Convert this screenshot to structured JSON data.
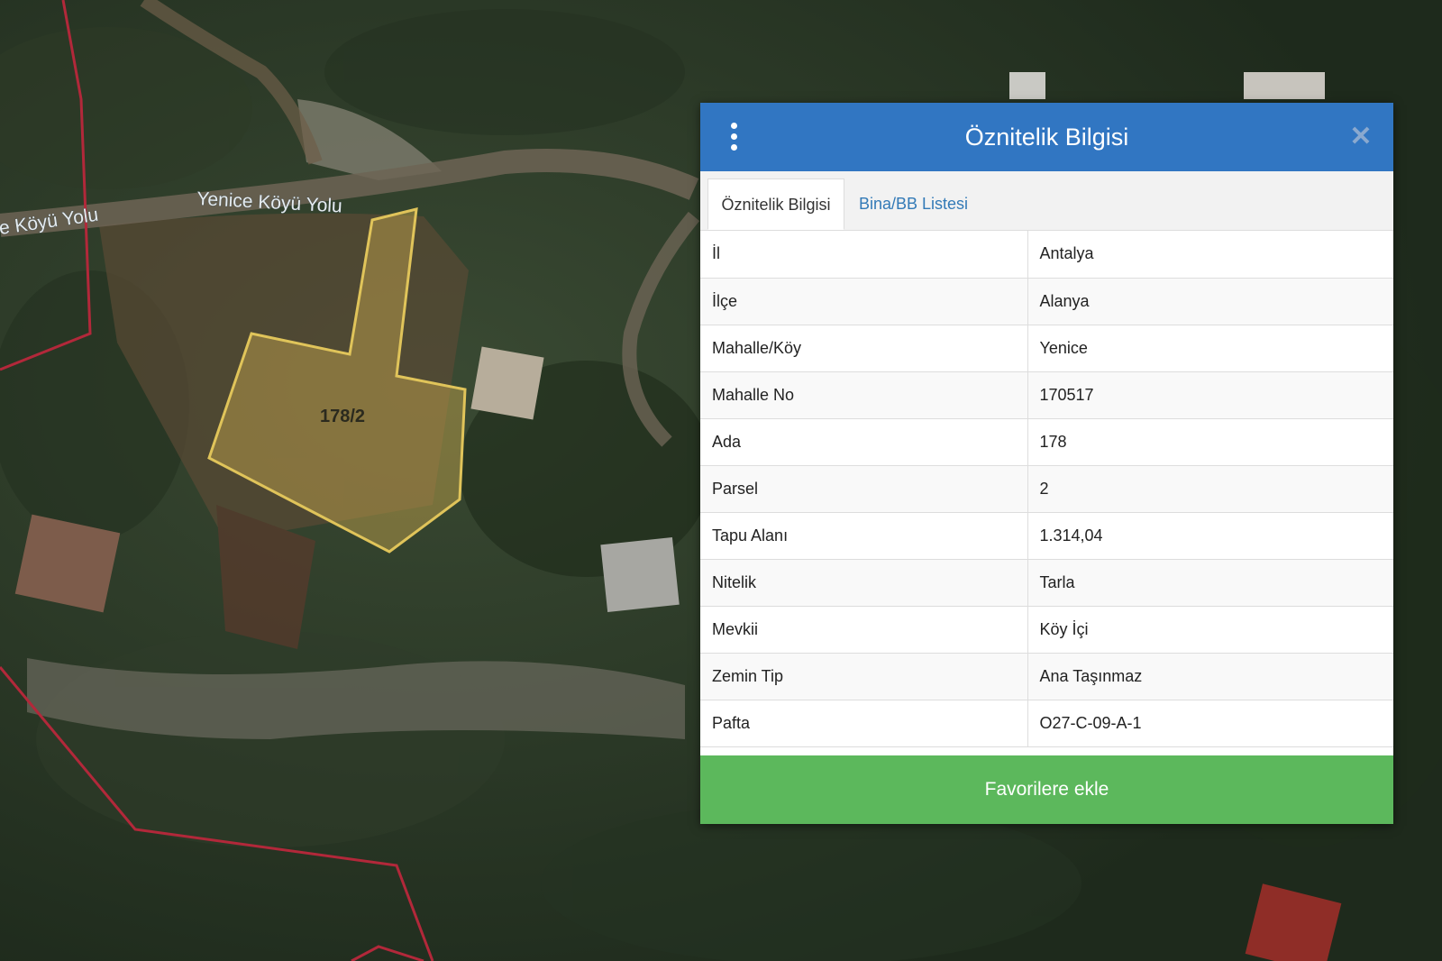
{
  "map": {
    "road_label_left": "e Köyü Yolu",
    "road_label_main": "Yenice Köyü Yolu",
    "parcel_label": "178/2",
    "colors": {
      "parcel_fill": "#c9a94e",
      "parcel_stroke": "#e0c45a",
      "boundary_line": "#b2283a"
    }
  },
  "panel": {
    "title": "Öznitelik Bilgisi",
    "menu_icon": "kebab-menu-icon",
    "close_icon": "close-icon",
    "header_color": "#3176c2",
    "tabs": [
      {
        "label": "Öznitelik Bilgisi",
        "active": true
      },
      {
        "label": "Bina/BB Listesi",
        "active": false
      }
    ],
    "rows": [
      {
        "key": "İl",
        "value": "Antalya"
      },
      {
        "key": "İlçe",
        "value": "Alanya"
      },
      {
        "key": "Mahalle/Köy",
        "value": "Yenice"
      },
      {
        "key": "Mahalle No",
        "value": "170517"
      },
      {
        "key": "Ada",
        "value": "178"
      },
      {
        "key": "Parsel",
        "value": "2"
      },
      {
        "key": "Tapu Alanı",
        "value": "1.314,04"
      },
      {
        "key": "Nitelik",
        "value": "Tarla"
      },
      {
        "key": "Mevkii",
        "value": "Köy İçi"
      },
      {
        "key": "Zemin Tip",
        "value": "Ana Taşınmaz"
      },
      {
        "key": "Pafta",
        "value": "O27-C-09-A-1"
      }
    ],
    "button_label": "Favorilere ekle",
    "button_color": "#5cb85c"
  }
}
